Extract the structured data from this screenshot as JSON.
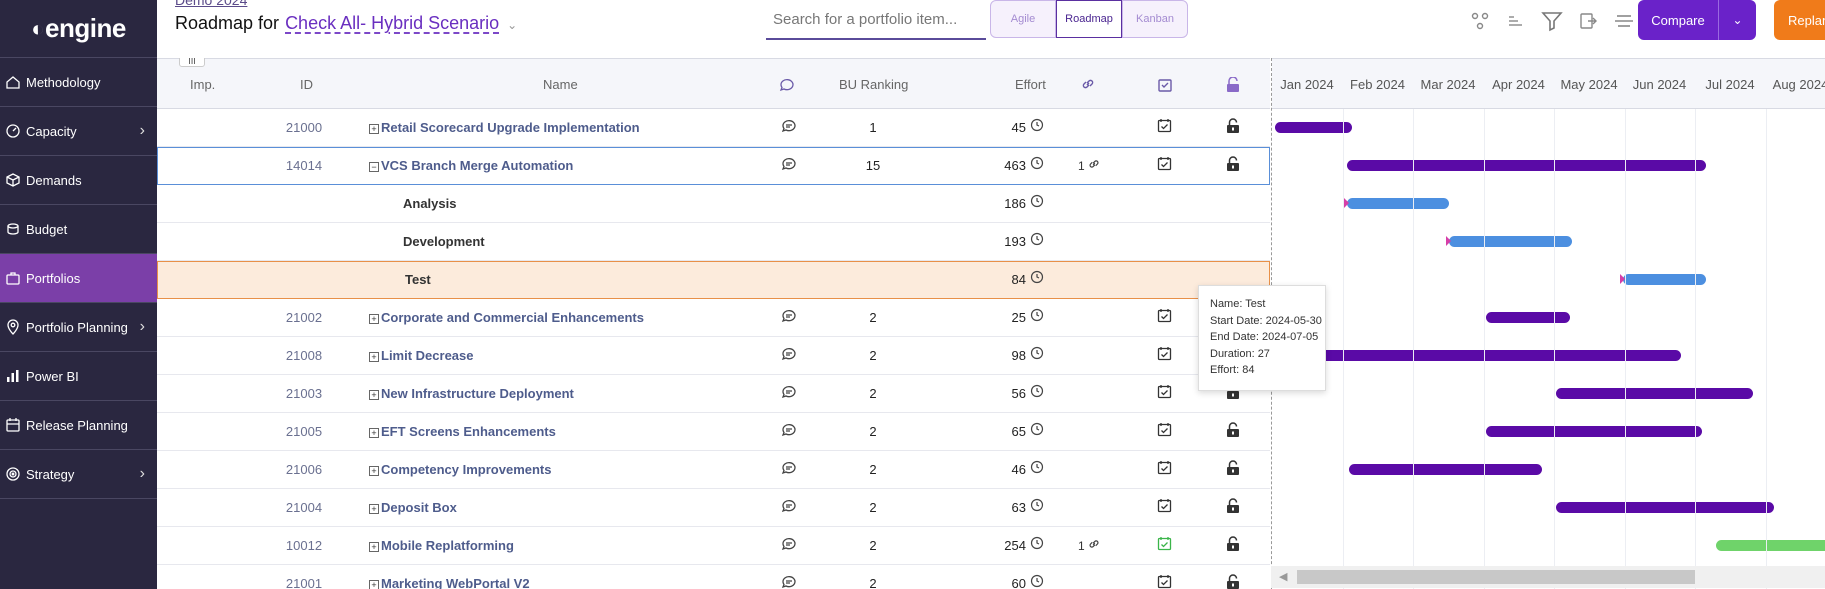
{
  "sidebar": {
    "logo": "engine",
    "items": [
      {
        "label": "Methodology",
        "icon": "methodology-icon",
        "chevron": false,
        "active": false
      },
      {
        "label": "Capacity",
        "icon": "capacity-icon",
        "chevron": true,
        "active": false
      },
      {
        "label": "Demands",
        "icon": "box-icon",
        "chevron": false,
        "active": false
      },
      {
        "label": "Budget",
        "icon": "coins-icon",
        "chevron": false,
        "active": false
      },
      {
        "label": "Portfolios",
        "icon": "briefcase-icon",
        "chevron": false,
        "active": true
      },
      {
        "label": "Portfolio Planning",
        "icon": "location-pin-icon",
        "chevron": true,
        "active": false
      },
      {
        "label": "Power BI",
        "icon": "chart-icon",
        "chevron": false,
        "active": false
      },
      {
        "label": "Release Planning",
        "icon": "calendar-icon",
        "chevron": false,
        "active": false
      },
      {
        "label": "Strategy",
        "icon": "target-icon",
        "chevron": true,
        "active": false
      }
    ]
  },
  "header": {
    "breadcrumb": "Demo 2024",
    "title_prefix": "Roadmap for",
    "scenario": "Check All- Hybrid Scenario",
    "search_placeholder": "Search for a portfolio item...",
    "views": [
      "Agile",
      "Roadmap",
      "Kanban"
    ],
    "active_view": "Roadmap",
    "compare_label": "Compare",
    "replan_label": "Replan"
  },
  "columns": {
    "imp": "Imp.",
    "id": "ID",
    "name": "Name",
    "bu_ranking": "BU Ranking",
    "effort": "Effort",
    "column_picker": "|||"
  },
  "rows": [
    {
      "id": "21000",
      "name": "Retail Scorecard Upgrade Implementation",
      "expand": "+",
      "rank": "1",
      "effort": "45",
      "link": "",
      "check_green": false,
      "type": "item"
    },
    {
      "id": "14014",
      "name": "VCS Branch Merge Automation",
      "expand": "−",
      "rank": "15",
      "effort": "463",
      "link": "1",
      "check_green": false,
      "type": "item",
      "selected": true
    },
    {
      "id": "",
      "name": "Analysis",
      "expand": "",
      "rank": "",
      "effort": "186",
      "link": "",
      "type": "phase"
    },
    {
      "id": "",
      "name": "Development",
      "expand": "",
      "rank": "",
      "effort": "193",
      "link": "",
      "type": "phase"
    },
    {
      "id": "",
      "name": "Test",
      "expand": "",
      "rank": "",
      "effort": "84",
      "link": "",
      "type": "phase",
      "highlight": true
    },
    {
      "id": "21002",
      "name": "Corporate and Commercial Enhancements",
      "expand": "+",
      "rank": "2",
      "effort": "25",
      "link": "",
      "check_green": false,
      "type": "item"
    },
    {
      "id": "21008",
      "name": "Limit Decrease",
      "expand": "+",
      "rank": "2",
      "effort": "98",
      "link": "",
      "check_green": false,
      "type": "item"
    },
    {
      "id": "21003",
      "name": "New Infrastructure Deployment",
      "expand": "+",
      "rank": "2",
      "effort": "56",
      "link": "",
      "check_green": false,
      "type": "item"
    },
    {
      "id": "21005",
      "name": "EFT Screens Enhancements",
      "expand": "+",
      "rank": "2",
      "effort": "65",
      "link": "",
      "check_green": false,
      "type": "item"
    },
    {
      "id": "21006",
      "name": "Competency Improvements",
      "expand": "+",
      "rank": "2",
      "effort": "46",
      "link": "",
      "check_green": false,
      "type": "item"
    },
    {
      "id": "21004",
      "name": "Deposit Box",
      "expand": "+",
      "rank": "2",
      "effort": "63",
      "link": "",
      "check_green": false,
      "type": "item"
    },
    {
      "id": "10012",
      "name": "Mobile Replatforming",
      "expand": "+",
      "rank": "2",
      "effort": "254",
      "link": "1",
      "check_green": true,
      "type": "item"
    },
    {
      "id": "21001",
      "name": "Marketing WebPortal V2",
      "expand": "+",
      "rank": "2",
      "effort": "60",
      "link": "",
      "check_green": false,
      "type": "item"
    }
  ],
  "gantt": {
    "months": [
      "Jan 2024",
      "Feb 2024",
      "Mar 2024",
      "Apr 2024",
      "May 2024",
      "Jun 2024",
      "Jul 2024",
      "Aug 2024"
    ],
    "timeline_start": "2024-01-01",
    "bars": [
      {
        "row": 0,
        "start": "2024-01-01",
        "end": "2024-02-03",
        "color": "purple"
      },
      {
        "row": 1,
        "start": "2024-02-01",
        "end": "2024-07-05",
        "color": "purple"
      },
      {
        "row": 2,
        "start": "2024-02-01",
        "end": "2024-03-16",
        "color": "blue"
      },
      {
        "row": 3,
        "start": "2024-03-16",
        "end": "2024-05-08",
        "color": "blue"
      },
      {
        "row": 4,
        "start": "2024-05-30",
        "end": "2024-07-05",
        "color": "blue"
      },
      {
        "row": 5,
        "start": "2024-04-01",
        "end": "2024-05-07",
        "color": "purple"
      },
      {
        "row": 6,
        "start": "2024-01-19",
        "end": "2024-06-24",
        "color": "purple"
      },
      {
        "row": 7,
        "start": "2024-05-01",
        "end": "2024-07-25",
        "color": "purple"
      },
      {
        "row": 8,
        "start": "2024-04-01",
        "end": "2024-07-03",
        "color": "purple"
      },
      {
        "row": 9,
        "start": "2024-02-02",
        "end": "2024-04-25",
        "color": "purple"
      },
      {
        "row": 10,
        "start": "2024-05-01",
        "end": "2024-08-03",
        "color": "purple"
      },
      {
        "row": 11,
        "start": "2024-07-09",
        "end": "2024-09-15",
        "color": "green"
      }
    ],
    "tooltip": {
      "name": "Name: Test",
      "start": "Start Date: 2024-05-30",
      "end": "End Date: 2024-07-05",
      "duration": "Duration: 27",
      "effort": "Effort: 84"
    }
  }
}
